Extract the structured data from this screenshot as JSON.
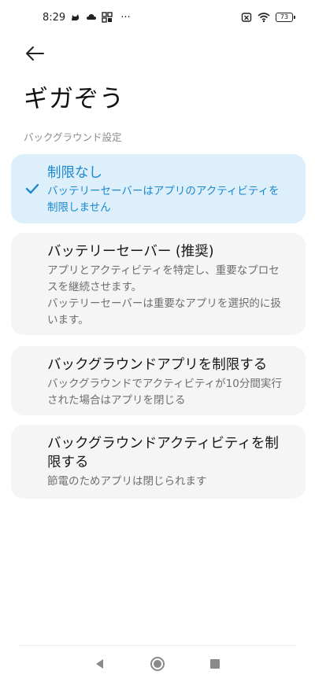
{
  "status_bar": {
    "time": "8:29",
    "battery": "73",
    "more": "···"
  },
  "header": {
    "title": "ギガぞう"
  },
  "section": {
    "label": "バックグラウンド設定"
  },
  "options": [
    {
      "title": "制限なし",
      "description": "バッテリーセーバーはアプリのアクティビティを制限しません",
      "selected": true
    },
    {
      "title": "バッテリーセーバー (推奨)",
      "description": "アプリとアクティビティを特定し、重要なプロセスを継続させます。\nバッテリーセーバーは重要なアプリを選択的に扱います。",
      "selected": false
    },
    {
      "title": "バックグラウンドアプリを制限する",
      "description": "バックグラウンドでアクティビティが10分間実行された場合はアプリを閉じる",
      "selected": false
    },
    {
      "title": "バックグラウンドアクティビティを制限する",
      "description": "節電のためアプリは閉じられます",
      "selected": false
    }
  ],
  "colors": {
    "accent": "#1b8ad0",
    "selected_bg": "#ddeffa",
    "card_bg": "#f5f5f5"
  }
}
